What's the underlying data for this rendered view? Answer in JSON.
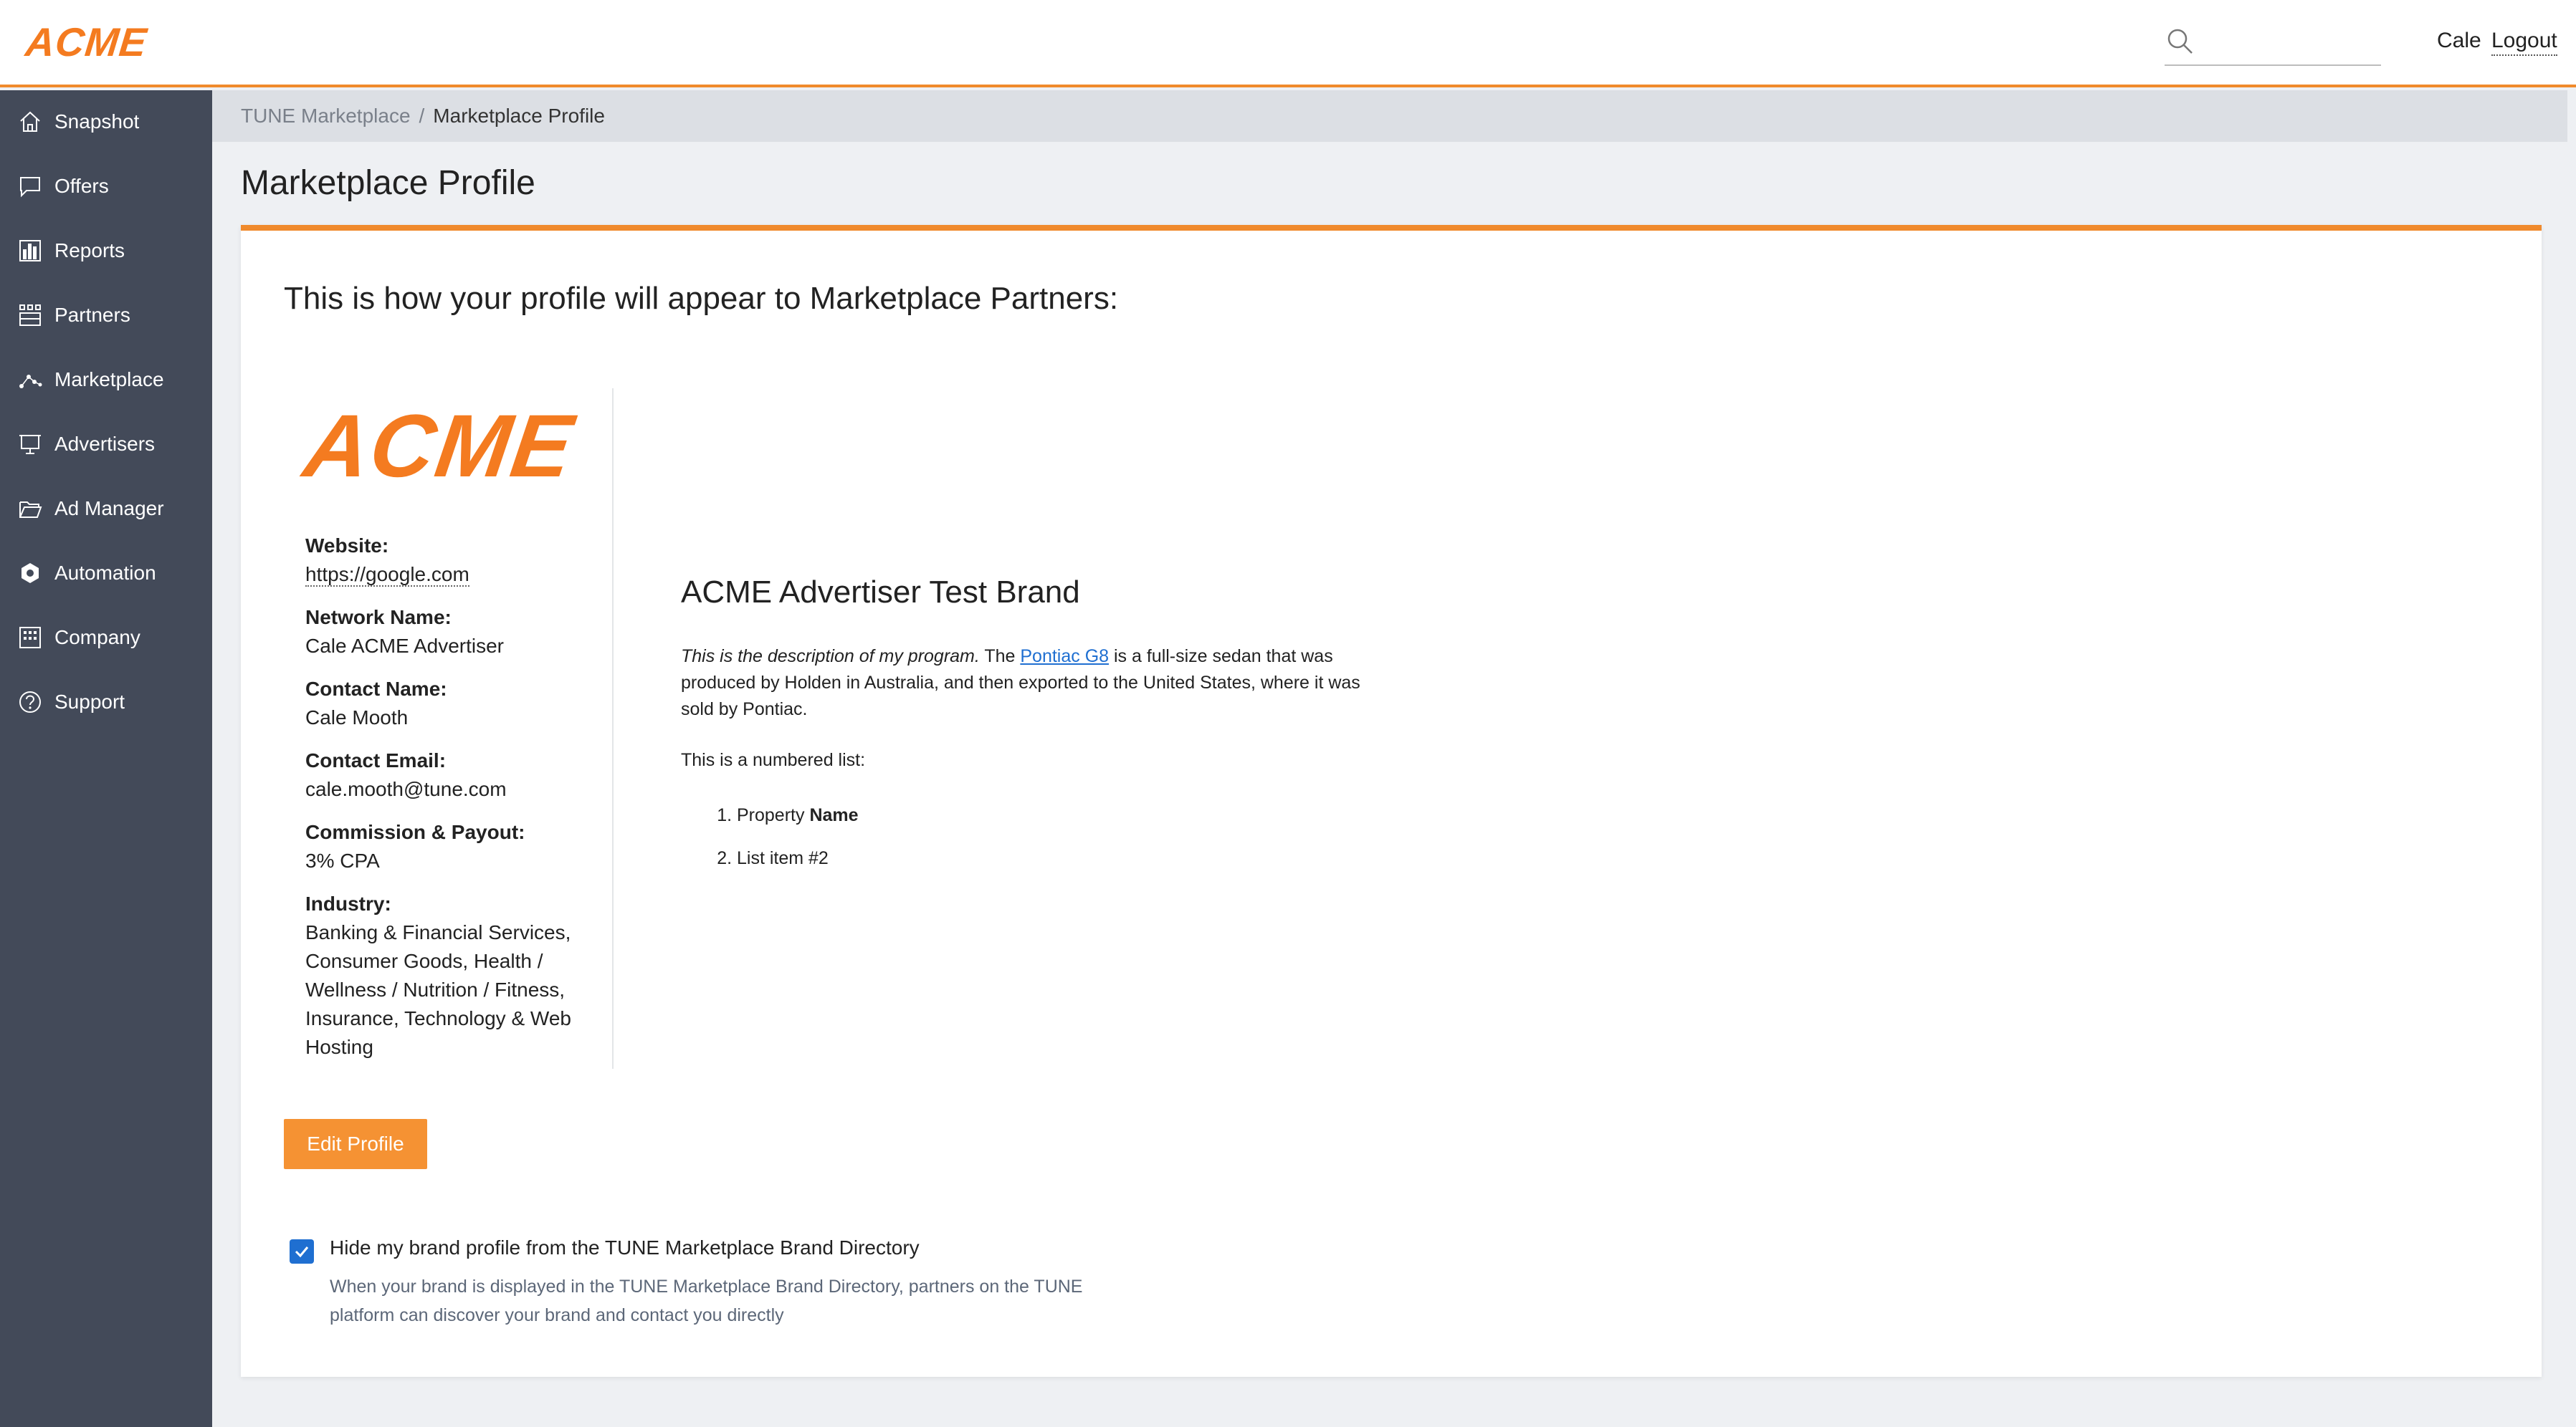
{
  "header": {
    "logo": "ACME",
    "search_placeholder": "",
    "user_name": "Cale",
    "logout_label": "Logout"
  },
  "sidebar": {
    "items": [
      {
        "label": "Snapshot",
        "icon": "home-icon"
      },
      {
        "label": "Offers",
        "icon": "chat-icon"
      },
      {
        "label": "Reports",
        "icon": "bar-chart-icon"
      },
      {
        "label": "Partners",
        "icon": "partners-icon"
      },
      {
        "label": "Marketplace",
        "icon": "network-icon"
      },
      {
        "label": "Advertisers",
        "icon": "presentation-icon"
      },
      {
        "label": "Ad Manager",
        "icon": "folder-icon"
      },
      {
        "label": "Automation",
        "icon": "automation-icon"
      },
      {
        "label": "Company",
        "icon": "building-icon"
      },
      {
        "label": "Support",
        "icon": "help-icon"
      }
    ]
  },
  "breadcrumb": {
    "parent": "TUNE Marketplace",
    "separator": "/",
    "current": "Marketplace Profile"
  },
  "page": {
    "title": "Marketplace Profile",
    "card_heading": "This is how your profile will appear to Marketplace Partners:"
  },
  "profile": {
    "logo": "ACME",
    "website_label": "Website:",
    "website_value": "https://google.com",
    "network_label": "Network Name:",
    "network_value": "Cale ACME Advertiser",
    "contact_label": "Contact Name:",
    "contact_value": "Cale Mooth",
    "email_label": "Contact Email:",
    "email_value": "cale.mooth@tune.com",
    "commission_label": "Commission & Payout:",
    "commission_value": "3% CPA",
    "industry_label": "Industry:",
    "industry_value": "Banking & Financial Services, Consumer Goods, Health / Wellness / Nutrition / Fitness, Insurance, Technology & Web Hosting"
  },
  "brand": {
    "title": "ACME Advertiser Test Brand",
    "desc_italic": "This is the description of my program.",
    "desc_pre": " The ",
    "desc_link": "Pontiac G8",
    "desc_post": " is a full-size sedan that was produced by Holden in Australia, and then exported to the United States, where it was sold by Pontiac.",
    "list_intro": "This is a numbered list:",
    "list_item1_pre": "Property ",
    "list_item1_bold": "Name",
    "list_item2": "List item #2"
  },
  "actions": {
    "edit_label": "Edit Profile"
  },
  "hide_option": {
    "checked": true,
    "label": "Hide my brand profile from the TUNE Marketplace Brand Directory",
    "help": "When your brand is displayed in the TUNE Marketplace Brand Directory, partners on the TUNE platform can discover your brand and contact you directly"
  },
  "colors": {
    "accent": "#f08a2c",
    "sidebar_bg": "#434a59",
    "link": "#1f6fd1"
  }
}
